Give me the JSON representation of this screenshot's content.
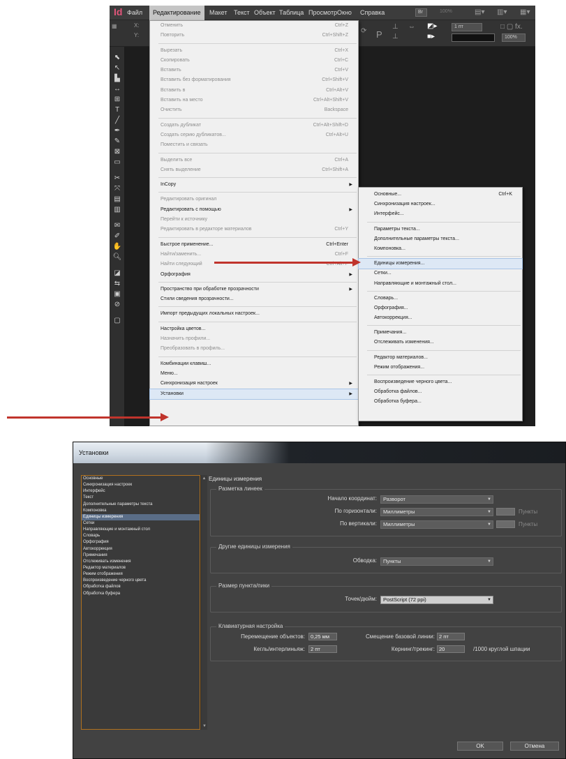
{
  "top": {
    "app_logo": "Id",
    "menubar": [
      {
        "label": "Файл"
      },
      {
        "label": "Редактирование",
        "active": true
      },
      {
        "label": "Макет"
      },
      {
        "label": "Текст"
      },
      {
        "label": "Объект"
      },
      {
        "label": "Таблица"
      },
      {
        "label": "Просмотр"
      },
      {
        "label": "Окно"
      },
      {
        "label": "Справка"
      }
    ],
    "menubar_br": "Br",
    "menubar_zoom": "100%",
    "control_zoom": "100%",
    "control_stroke": "1 пт",
    "edit_menu": [
      {
        "label": "Отменить",
        "shortcut": "Ctrl+Z",
        "disabled": true
      },
      {
        "label": "Повторить",
        "shortcut": "Ctrl+Shift+Z",
        "disabled": true
      },
      {
        "sep": true
      },
      {
        "label": "Вырезать",
        "shortcut": "Ctrl+X",
        "disabled": true
      },
      {
        "label": "Скопировать",
        "shortcut": "Ctrl+C",
        "disabled": true
      },
      {
        "label": "Вставить",
        "shortcut": "Ctrl+V",
        "disabled": true
      },
      {
        "label": "Вставить без форматирования",
        "shortcut": "Ctrl+Shift+V",
        "disabled": true
      },
      {
        "label": "Вставить в",
        "shortcut": "Ctrl+Alt+V",
        "disabled": true
      },
      {
        "label": "Вставить на место",
        "shortcut": "Ctrl+Alt+Shift+V",
        "disabled": true
      },
      {
        "label": "Очистить",
        "shortcut": "Backspace",
        "disabled": true
      },
      {
        "sep": true
      },
      {
        "label": "Создать дубликат",
        "shortcut": "Ctrl+Alt+Shift+D",
        "disabled": true
      },
      {
        "label": "Создать серию дубликатов...",
        "shortcut": "Ctrl+Alt+U",
        "disabled": true
      },
      {
        "label": "Поместить и связать",
        "disabled": true
      },
      {
        "sep": true
      },
      {
        "label": "Выделить все",
        "shortcut": "Ctrl+A",
        "disabled": true
      },
      {
        "label": "Снять выделение",
        "shortcut": "Ctrl+Shift+A",
        "disabled": true
      },
      {
        "sep": true
      },
      {
        "label": "InCopy",
        "submenu": true
      },
      {
        "sep": true
      },
      {
        "label": "Редактировать оригинал",
        "disabled": true
      },
      {
        "label": "Редактировать с помощью",
        "submenu": true
      },
      {
        "label": "Перейти к источнику",
        "disabled": true
      },
      {
        "label": "Редактировать в редакторе материалов",
        "shortcut": "Ctrl+Y",
        "disabled": true
      },
      {
        "sep": true
      },
      {
        "label": "Быстрое применение...",
        "shortcut": "Ctrl+Enter"
      },
      {
        "label": "Найти/заменить...",
        "shortcut": "Ctrl+F",
        "disabled": true
      },
      {
        "label": "Найти следующий",
        "shortcut": "Ctrl+Alt+F",
        "disabled": true
      },
      {
        "label": "Орфография",
        "submenu": true
      },
      {
        "sep": true
      },
      {
        "label": "Пространство при обработке прозрачности",
        "submenu": true
      },
      {
        "label": "Стили сведения прозрачности..."
      },
      {
        "sep": true
      },
      {
        "label": "Импорт предыдущих локальных настроек..."
      },
      {
        "sep": true
      },
      {
        "label": "Настройка цветов..."
      },
      {
        "label": "Назначить профили...",
        "disabled": true
      },
      {
        "label": "Преобразовать в профиль...",
        "disabled": true
      },
      {
        "sep": true
      },
      {
        "label": "Комбинации клавиш..."
      },
      {
        "label": "Меню..."
      },
      {
        "label": "Синхронизация настроек",
        "submenu": true
      },
      {
        "label": "Установки",
        "submenu": true,
        "highlight": true
      }
    ],
    "submenu": [
      {
        "label": "Основные...",
        "shortcut": "Ctrl+K"
      },
      {
        "label": "Синхронизация настроек..."
      },
      {
        "label": "Интерфейс..."
      },
      {
        "sep": true
      },
      {
        "label": "Параметры текста..."
      },
      {
        "label": "Дополнительные параметры текста..."
      },
      {
        "label": "Компоновка..."
      },
      {
        "sep": true
      },
      {
        "label": "Единицы измерения...",
        "highlight": true
      },
      {
        "label": "Сетки..."
      },
      {
        "label": "Направляющие и монтажный стол..."
      },
      {
        "sep": true
      },
      {
        "label": "Словарь..."
      },
      {
        "label": "Орфография..."
      },
      {
        "label": "Автокоррекция..."
      },
      {
        "sep": true
      },
      {
        "label": "Примечания..."
      },
      {
        "label": "Отслеживать изменения..."
      },
      {
        "sep": true
      },
      {
        "label": "Редактор материалов..."
      },
      {
        "label": "Режим отображения..."
      },
      {
        "sep": true
      },
      {
        "label": "Воспроизведение черного цвета..."
      },
      {
        "label": "Обработка файлов..."
      },
      {
        "label": "Обработка буфера..."
      }
    ]
  },
  "dialog": {
    "title": "Установки",
    "categories": [
      {
        "label": "Основные"
      },
      {
        "label": "Синхронизация настроек"
      },
      {
        "label": "Интерфейс"
      },
      {
        "label": "Текст"
      },
      {
        "label": "Дополнительные параметры текста"
      },
      {
        "label": "Компоновка"
      },
      {
        "label": "Единицы измерения",
        "selected": true
      },
      {
        "label": "Сетки"
      },
      {
        "label": "Направляющие и монтажный стол"
      },
      {
        "label": "Словарь"
      },
      {
        "label": "Орфография"
      },
      {
        "label": "Автокоррекция"
      },
      {
        "label": "Примечания"
      },
      {
        "label": "Отслеживать изменения"
      },
      {
        "label": "Редактор материалов"
      },
      {
        "label": "Режим отображения"
      },
      {
        "label": "Воспроизведение черного цвета"
      },
      {
        "label": "Обработка файлов"
      },
      {
        "label": "Обработка буфера"
      }
    ],
    "panel_heading": "Единицы измерения",
    "rulers": {
      "title": "Разметка линеек",
      "origin_label": "Начало координат:",
      "origin_value": "Разворот",
      "horizontal_label": "По горизонтали:",
      "horizontal_value": "Миллиметры",
      "horizontal_unit": "Пункты",
      "vertical_label": "По вертикали:",
      "vertical_value": "Миллиметры",
      "vertical_unit": "Пункты"
    },
    "other": {
      "title": "Другие единицы измерения",
      "stroke_label": "Обводка:",
      "stroke_value": "Пункты"
    },
    "point": {
      "title": "Размер пункта/пики",
      "ppi_label": "Точек/дюйм:",
      "ppi_value": "PostScript (72 ppi)"
    },
    "keyboard": {
      "title": "Клавиатурная настройка",
      "move_label": "Перемещение объектов:",
      "move_value": "0,25 мм",
      "baseline_label": "Смещение базовой линии:",
      "baseline_value": "2 пт",
      "size_label": "Кегль/интерлиньяж:",
      "size_value": "2 пт",
      "kerning_label": "Кернинг/трекинг:",
      "kerning_value": "20",
      "kerning_suffix": "/1000 круглой шпации"
    },
    "ok_label": "OK",
    "cancel_label": "Отмена"
  }
}
